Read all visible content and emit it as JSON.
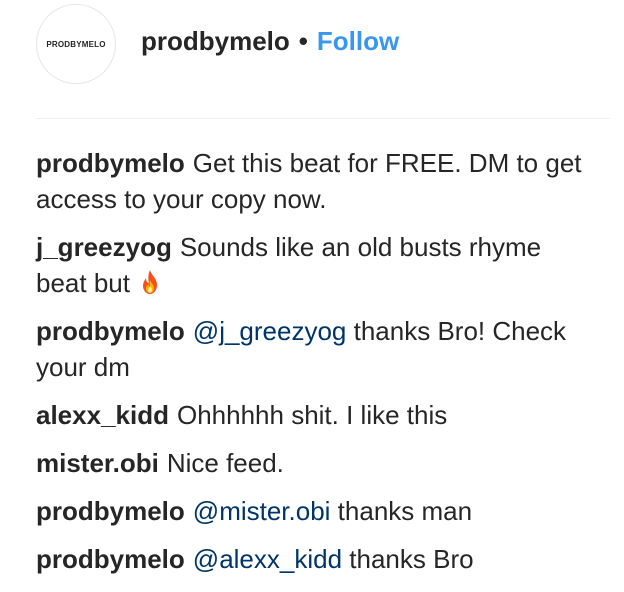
{
  "post_header": {
    "avatar_text": "PRODBYMELO",
    "username": "prodbymelo",
    "separator": "•",
    "follow_label": "Follow"
  },
  "comments": [
    {
      "username": "prodbymelo",
      "text": "Get this beat for FREE. DM to get access to your copy now."
    },
    {
      "username": "j_greezyog",
      "text": "Sounds like an old busts rhyme beat but",
      "emoji": "fire-icon"
    },
    {
      "username": "prodbymelo",
      "mention": "@j_greezyog",
      "text": " thanks Bro! Check your dm"
    },
    {
      "username": "alexx_kidd",
      "text": "Ohhhhhh shit. I like this"
    },
    {
      "username": "mister.obi",
      "text": "Nice feed."
    },
    {
      "username": "prodbymelo",
      "mention": "@mister.obi",
      "text": " thanks man"
    },
    {
      "username": "prodbymelo",
      "mention": "@alexx_kidd",
      "text": " thanks Bro"
    }
  ],
  "colors": {
    "text": "#262626",
    "follow": "#3897f0",
    "mention": "#003569",
    "divider": "#efefef"
  }
}
